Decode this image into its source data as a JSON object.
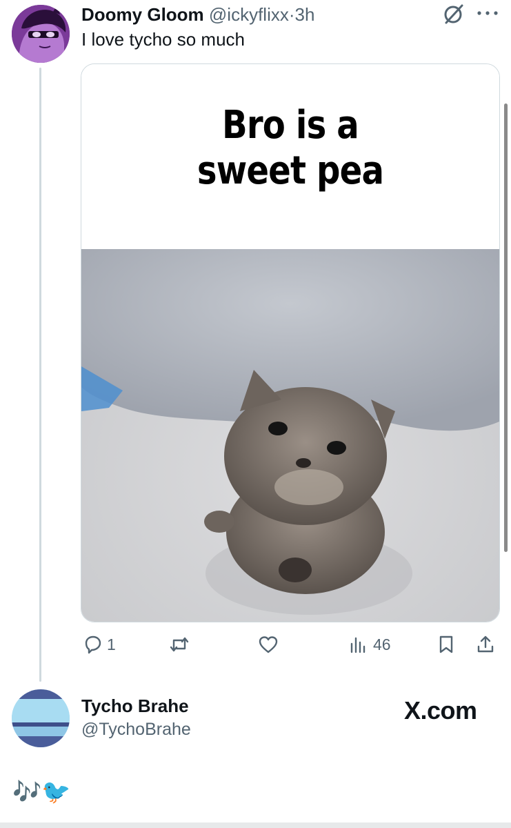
{
  "tweet": {
    "author_name": "Doomy Gloom",
    "author_handle": "@ickyflixx",
    "separator": "·",
    "time": "3h",
    "text": "I love tycho so much",
    "media_caption_line1": "Bro is a",
    "media_caption_line2": "sweet pea"
  },
  "actions": {
    "reply_count": "1",
    "view_count": "46"
  },
  "embed_author": {
    "name": "Tycho Brahe",
    "handle": "@TychoBrahe",
    "site": "X.com"
  },
  "footer": {
    "emoji": "🎶🐦"
  },
  "colors": {
    "text_primary": "#0f1419",
    "text_secondary": "#536471",
    "border": "#cfd9de"
  },
  "icons": [
    "reply-icon",
    "retweet-icon",
    "like-icon",
    "views-icon",
    "bookmark-icon",
    "share-icon",
    "grok-icon",
    "more-icon"
  ]
}
